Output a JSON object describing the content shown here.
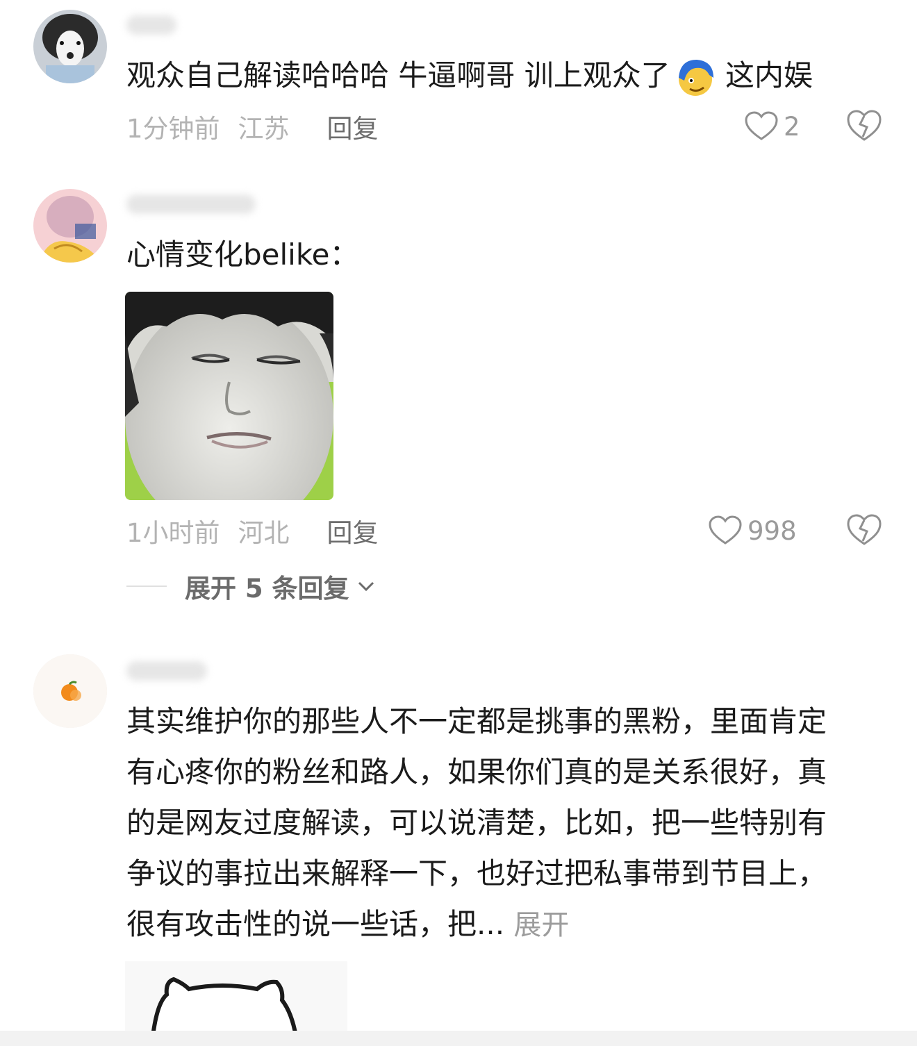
{
  "comments": [
    {
      "text_before": "观众自己解读哈哈哈 牛逼啊哥 训上观众了",
      "emoji": "yellow-face-with-blue-hair-emoji",
      "text_after": " 这内娱",
      "time": "1分钟前",
      "location": "江苏",
      "reply_label": "回复",
      "likes": "2"
    },
    {
      "text": "心情变化belike：",
      "image": "meme-face-eyes-closed",
      "time": "1小时前",
      "location": "河北",
      "reply_label": "回复",
      "likes": "998",
      "expand_replies": "展开 5 条回复"
    },
    {
      "lines": [
        "其实维护你的那些人不一定都是挑事的黑粉，里面肯定",
        "有心疼你的粉丝和路人，如果你们真的是关系很好，真",
        "的是网友过度解读，可以说清楚，比如，把一些特别有",
        "争议的事拉出来解释一下，也好过把私事带到节目上，",
        "很有攻击性的说一些话，把..."
      ],
      "expand_label": "展开",
      "image": "cartoon-cat-sketch"
    }
  ],
  "colors": {
    "meta_gray": "#b3b3b3",
    "reply_gray": "#6d6d6d",
    "text": "#1b1b1b"
  }
}
